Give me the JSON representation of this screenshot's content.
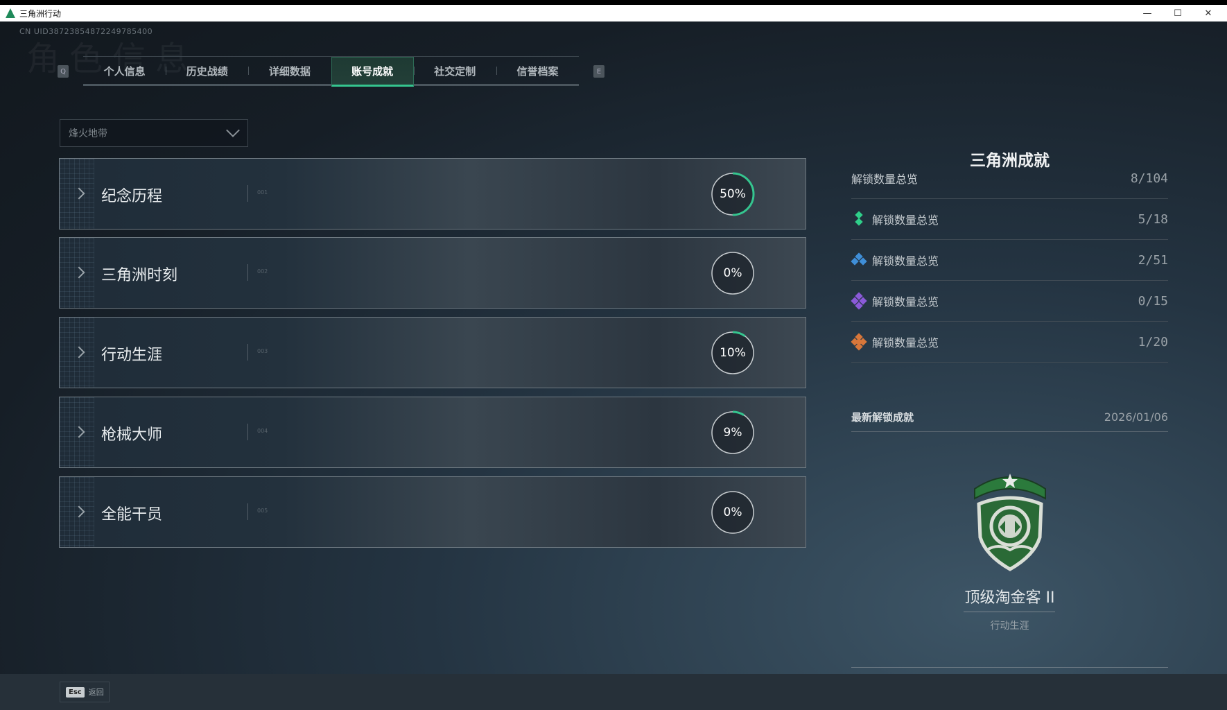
{
  "window": {
    "title": "三角洲行动",
    "minimize": "—",
    "maximize": "☐",
    "close": "✕"
  },
  "uid": "CN UID3872385487224978540​0",
  "ghost_title": "角色信息",
  "tabs": {
    "left_key": "Q",
    "right_key": "E",
    "items": [
      {
        "label": "个人信息",
        "active": false
      },
      {
        "label": "历史战绩",
        "active": false
      },
      {
        "label": "详细数据",
        "active": false
      },
      {
        "label": "账号成就",
        "active": true
      },
      {
        "label": "社交定制",
        "active": false
      },
      {
        "label": "信誉档案",
        "active": false
      }
    ]
  },
  "mode_select": {
    "value": "烽火地带"
  },
  "categories": [
    {
      "label": "纪念历程",
      "num": "001",
      "progress": 50,
      "progress_label": "50%"
    },
    {
      "label": "三角洲时刻",
      "num": "002",
      "progress": 0,
      "progress_label": "0%"
    },
    {
      "label": "行动生涯",
      "num": "003",
      "progress": 10,
      "progress_label": "10%"
    },
    {
      "label": "枪械大师",
      "num": "004",
      "progress": 9,
      "progress_label": "9%"
    },
    {
      "label": "全能干员",
      "num": "005",
      "progress": 0,
      "progress_label": "0%"
    }
  ],
  "summary": {
    "title": "三角洲成就",
    "total": {
      "label": "解锁数量总览",
      "value": "8/104"
    },
    "tiers": [
      {
        "label": "解锁数量总览",
        "value": "5/18",
        "icon": "green-tier-icon",
        "color": "#2fcf8a"
      },
      {
        "label": "解锁数量总览",
        "value": "2/51",
        "icon": "blue-tier-icon",
        "color": "#3f8fd8"
      },
      {
        "label": "解锁数量总览",
        "value": "0/15",
        "icon": "purple-tier-icon",
        "color": "#8b5ad8"
      },
      {
        "label": "解锁数量总览",
        "value": "1/20",
        "icon": "orange-tier-icon",
        "color": "#d9773a"
      }
    ]
  },
  "latest": {
    "label": "最新解锁成就",
    "date": "2026/01/06",
    "name": "顶级淘金客 II",
    "category": "行动生涯"
  },
  "footer": {
    "esc_key": "Esc",
    "esc_label": "返回"
  },
  "colors": {
    "accent": "#35c58f"
  }
}
